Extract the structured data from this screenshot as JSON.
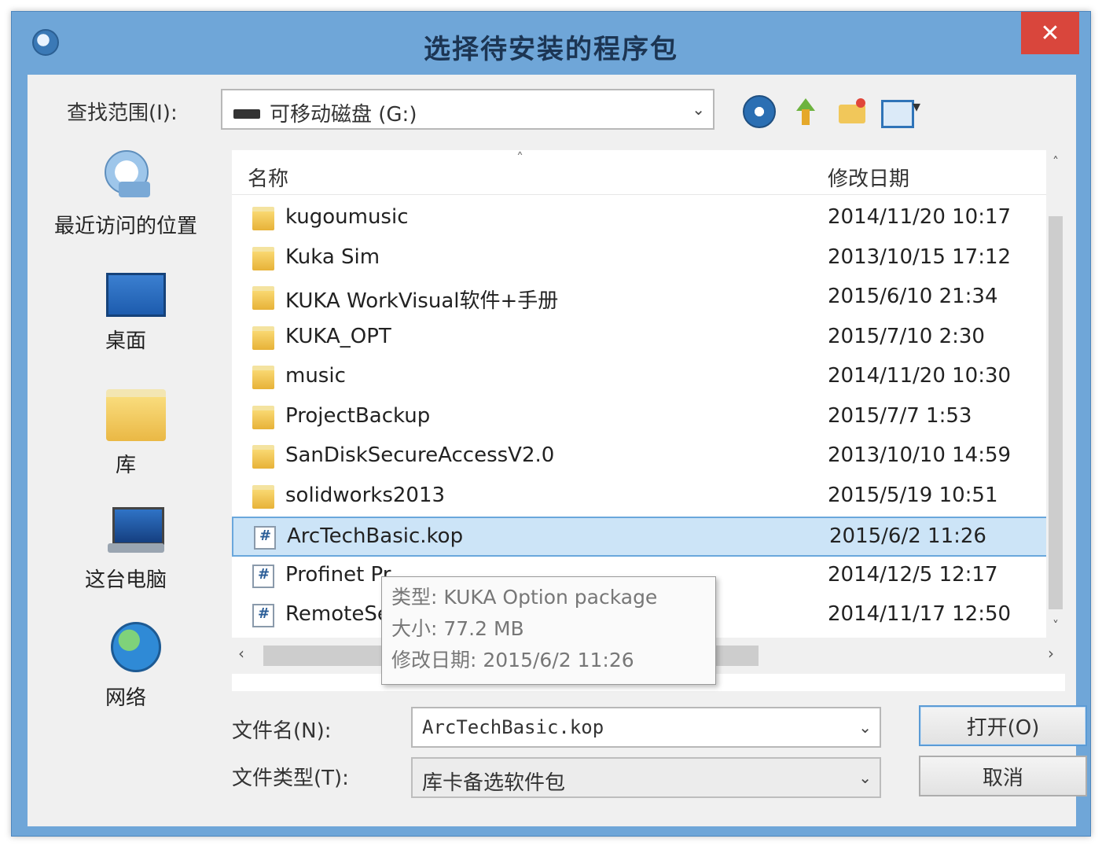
{
  "window": {
    "title": "选择待安装的程序包",
    "close_glyph": "✕"
  },
  "toolbar": {
    "lookin_label": "查找范围(I):",
    "lookin_value": "可移动磁盘 (G:)",
    "icons": [
      "back-icon",
      "up-folder-icon",
      "new-folder-icon",
      "view-menu-icon"
    ]
  },
  "places": [
    {
      "label": "最近访问的位置",
      "icon": "recent-places-icon"
    },
    {
      "label": "桌面",
      "icon": "desktop-icon"
    },
    {
      "label": "库",
      "icon": "library-icon"
    },
    {
      "label": "这台电脑",
      "icon": "computer-icon"
    },
    {
      "label": "网络",
      "icon": "network-icon"
    }
  ],
  "filelist": {
    "header_name": "名称",
    "header_date": "修改日期",
    "rows": [
      {
        "name": "kugoumusic",
        "date": "2014/11/20 10:17",
        "type": "folder"
      },
      {
        "name": "Kuka Sim",
        "date": "2013/10/15 17:12",
        "type": "folder"
      },
      {
        "name": "KUKA WorkVisual软件+手册",
        "date": "2015/6/10 21:34",
        "type": "folder"
      },
      {
        "name": "KUKA_OPT",
        "date": "2015/7/10 2:30",
        "type": "folder"
      },
      {
        "name": "music",
        "date": "2014/11/20 10:30",
        "type": "folder"
      },
      {
        "name": "ProjectBackup",
        "date": "2015/7/7 1:53",
        "type": "folder"
      },
      {
        "name": "SanDiskSecureAccessV2.0",
        "date": "2013/10/10 14:59",
        "type": "folder"
      },
      {
        "name": "solidworks2013",
        "date": "2015/5/19 10:51",
        "type": "folder"
      },
      {
        "name": "ArcTechBasic.kop",
        "date": "2015/6/2 11:26",
        "type": "file",
        "selected": true
      },
      {
        "name": "Profinet Pr",
        "date": "2014/12/5 12:17",
        "type": "file"
      },
      {
        "name": "RemoteSe",
        "date": "2014/11/17 12:50",
        "type": "file"
      }
    ]
  },
  "tooltip": {
    "type_line": "类型: KUKA Option package",
    "size_line": "大小: 77.2 MB",
    "date_line": "修改日期: 2015/6/2 11:26"
  },
  "footer": {
    "filename_label": "文件名(N):",
    "filename_value": "ArcTechBasic.kop",
    "filetype_label": "文件类型(T):",
    "filetype_value": "库卡备选软件包",
    "open_label": "打开(O)",
    "cancel_label": "取消"
  }
}
